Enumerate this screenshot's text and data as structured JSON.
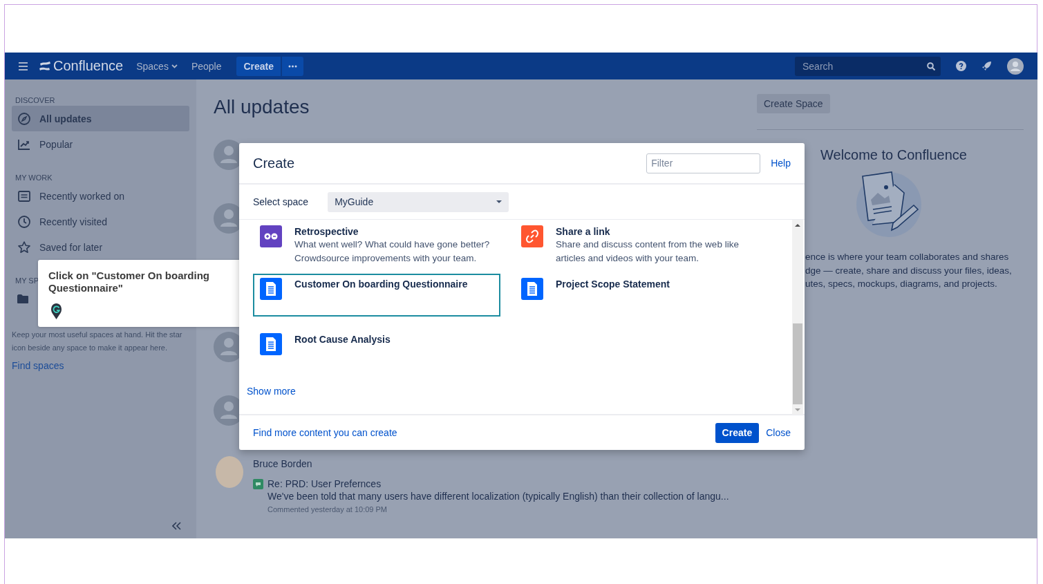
{
  "topbar": {
    "product": "Confluence",
    "nav": [
      {
        "label": "Spaces",
        "dropdown": true
      },
      {
        "label": "People",
        "dropdown": false
      }
    ],
    "create_button": "Create",
    "search": {
      "placeholder": "Search"
    }
  },
  "sidebar": {
    "sections": [
      {
        "heading": "DISCOVER",
        "items": [
          {
            "label": "All updates",
            "selected": true
          },
          {
            "label": "Popular",
            "selected": false
          }
        ]
      },
      {
        "heading": "MY WORK",
        "items": [
          {
            "label": "Recently worked on",
            "selected": false
          },
          {
            "label": "Recently visited",
            "selected": false
          },
          {
            "label": "Saved for later",
            "selected": false
          }
        ]
      }
    ],
    "spaces": {
      "heading": "MY SP",
      "hint": "Keep your most useful spaces at hand. Hit the star icon beside any space to make it appear here.",
      "link": "Find spaces"
    }
  },
  "main": {
    "title": "All updates",
    "feed": [
      {
        "kind": "silhouette"
      },
      {
        "kind": "silhouette"
      },
      {
        "kind": "silhouette"
      },
      {
        "kind": "silhouette"
      },
      {
        "kind": "photo",
        "author": "Bruce Borden",
        "title": "Re: PRD: User Prefernces",
        "excerpt": "We've been told that many users have different localization (typically English) than their collection of langu...",
        "meta": "Commented yesterday at 10:09 PM"
      }
    ]
  },
  "aside": {
    "create_space_button": "Create Space",
    "title": "Welcome to Confluence",
    "lines": [
      "ence is where your team collaborates and shares",
      "dge — create, share and discuss your files, ideas,",
      "utes, specs, mockups, diagrams, and projects."
    ]
  },
  "dialog": {
    "title": "Create",
    "filter": {
      "placeholder": "Filter"
    },
    "help": "Help",
    "space_label": "Select space",
    "space_value": "MyGuide",
    "templates": [
      {
        "title": "Retrospective",
        "description": "What went well? What could have gone better? Crowdsource improvements with your team.",
        "kind": "retrospective",
        "selected": false
      },
      {
        "title": "Share a link",
        "description": "Share and discuss content from the web like articles and videos with your team.",
        "kind": "link",
        "selected": false
      },
      {
        "title": "Customer On boarding Questionnaire",
        "kind": "document",
        "selected": true
      },
      {
        "title": "Project Scope Statement",
        "kind": "document",
        "selected": false
      },
      {
        "title": "Root Cause Analysis",
        "kind": "document",
        "selected": false
      }
    ],
    "show_more": "Show more",
    "footer_link": "Find more content you can create",
    "primary_button": "Create",
    "close": "Close"
  },
  "tooltip": {
    "text": "Click on \"Customer On boarding Questionnaire\""
  }
}
